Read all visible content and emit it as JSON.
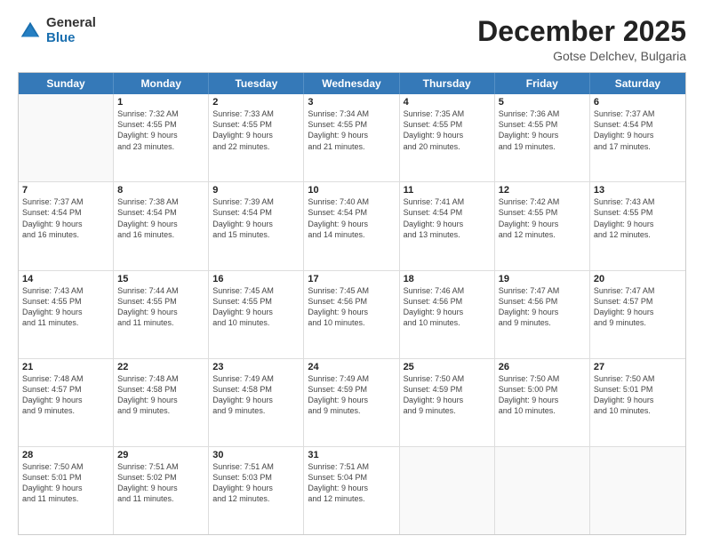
{
  "header": {
    "logo_general": "General",
    "logo_blue": "Blue",
    "month_title": "December 2025",
    "location": "Gotse Delchev, Bulgaria"
  },
  "days_of_week": [
    "Sunday",
    "Monday",
    "Tuesday",
    "Wednesday",
    "Thursday",
    "Friday",
    "Saturday"
  ],
  "rows": [
    [
      {
        "day": "",
        "lines": []
      },
      {
        "day": "1",
        "lines": [
          "Sunrise: 7:32 AM",
          "Sunset: 4:55 PM",
          "Daylight: 9 hours",
          "and 23 minutes."
        ]
      },
      {
        "day": "2",
        "lines": [
          "Sunrise: 7:33 AM",
          "Sunset: 4:55 PM",
          "Daylight: 9 hours",
          "and 22 minutes."
        ]
      },
      {
        "day": "3",
        "lines": [
          "Sunrise: 7:34 AM",
          "Sunset: 4:55 PM",
          "Daylight: 9 hours",
          "and 21 minutes."
        ]
      },
      {
        "day": "4",
        "lines": [
          "Sunrise: 7:35 AM",
          "Sunset: 4:55 PM",
          "Daylight: 9 hours",
          "and 20 minutes."
        ]
      },
      {
        "day": "5",
        "lines": [
          "Sunrise: 7:36 AM",
          "Sunset: 4:55 PM",
          "Daylight: 9 hours",
          "and 19 minutes."
        ]
      },
      {
        "day": "6",
        "lines": [
          "Sunrise: 7:37 AM",
          "Sunset: 4:54 PM",
          "Daylight: 9 hours",
          "and 17 minutes."
        ]
      }
    ],
    [
      {
        "day": "7",
        "lines": [
          "Sunrise: 7:37 AM",
          "Sunset: 4:54 PM",
          "Daylight: 9 hours",
          "and 16 minutes."
        ]
      },
      {
        "day": "8",
        "lines": [
          "Sunrise: 7:38 AM",
          "Sunset: 4:54 PM",
          "Daylight: 9 hours",
          "and 16 minutes."
        ]
      },
      {
        "day": "9",
        "lines": [
          "Sunrise: 7:39 AM",
          "Sunset: 4:54 PM",
          "Daylight: 9 hours",
          "and 15 minutes."
        ]
      },
      {
        "day": "10",
        "lines": [
          "Sunrise: 7:40 AM",
          "Sunset: 4:54 PM",
          "Daylight: 9 hours",
          "and 14 minutes."
        ]
      },
      {
        "day": "11",
        "lines": [
          "Sunrise: 7:41 AM",
          "Sunset: 4:54 PM",
          "Daylight: 9 hours",
          "and 13 minutes."
        ]
      },
      {
        "day": "12",
        "lines": [
          "Sunrise: 7:42 AM",
          "Sunset: 4:55 PM",
          "Daylight: 9 hours",
          "and 12 minutes."
        ]
      },
      {
        "day": "13",
        "lines": [
          "Sunrise: 7:43 AM",
          "Sunset: 4:55 PM",
          "Daylight: 9 hours",
          "and 12 minutes."
        ]
      }
    ],
    [
      {
        "day": "14",
        "lines": [
          "Sunrise: 7:43 AM",
          "Sunset: 4:55 PM",
          "Daylight: 9 hours",
          "and 11 minutes."
        ]
      },
      {
        "day": "15",
        "lines": [
          "Sunrise: 7:44 AM",
          "Sunset: 4:55 PM",
          "Daylight: 9 hours",
          "and 11 minutes."
        ]
      },
      {
        "day": "16",
        "lines": [
          "Sunrise: 7:45 AM",
          "Sunset: 4:55 PM",
          "Daylight: 9 hours",
          "and 10 minutes."
        ]
      },
      {
        "day": "17",
        "lines": [
          "Sunrise: 7:45 AM",
          "Sunset: 4:56 PM",
          "Daylight: 9 hours",
          "and 10 minutes."
        ]
      },
      {
        "day": "18",
        "lines": [
          "Sunrise: 7:46 AM",
          "Sunset: 4:56 PM",
          "Daylight: 9 hours",
          "and 10 minutes."
        ]
      },
      {
        "day": "19",
        "lines": [
          "Sunrise: 7:47 AM",
          "Sunset: 4:56 PM",
          "Daylight: 9 hours",
          "and 9 minutes."
        ]
      },
      {
        "day": "20",
        "lines": [
          "Sunrise: 7:47 AM",
          "Sunset: 4:57 PM",
          "Daylight: 9 hours",
          "and 9 minutes."
        ]
      }
    ],
    [
      {
        "day": "21",
        "lines": [
          "Sunrise: 7:48 AM",
          "Sunset: 4:57 PM",
          "Daylight: 9 hours",
          "and 9 minutes."
        ]
      },
      {
        "day": "22",
        "lines": [
          "Sunrise: 7:48 AM",
          "Sunset: 4:58 PM",
          "Daylight: 9 hours",
          "and 9 minutes."
        ]
      },
      {
        "day": "23",
        "lines": [
          "Sunrise: 7:49 AM",
          "Sunset: 4:58 PM",
          "Daylight: 9 hours",
          "and 9 minutes."
        ]
      },
      {
        "day": "24",
        "lines": [
          "Sunrise: 7:49 AM",
          "Sunset: 4:59 PM",
          "Daylight: 9 hours",
          "and 9 minutes."
        ]
      },
      {
        "day": "25",
        "lines": [
          "Sunrise: 7:50 AM",
          "Sunset: 4:59 PM",
          "Daylight: 9 hours",
          "and 9 minutes."
        ]
      },
      {
        "day": "26",
        "lines": [
          "Sunrise: 7:50 AM",
          "Sunset: 5:00 PM",
          "Daylight: 9 hours",
          "and 10 minutes."
        ]
      },
      {
        "day": "27",
        "lines": [
          "Sunrise: 7:50 AM",
          "Sunset: 5:01 PM",
          "Daylight: 9 hours",
          "and 10 minutes."
        ]
      }
    ],
    [
      {
        "day": "28",
        "lines": [
          "Sunrise: 7:50 AM",
          "Sunset: 5:01 PM",
          "Daylight: 9 hours",
          "and 11 minutes."
        ]
      },
      {
        "day": "29",
        "lines": [
          "Sunrise: 7:51 AM",
          "Sunset: 5:02 PM",
          "Daylight: 9 hours",
          "and 11 minutes."
        ]
      },
      {
        "day": "30",
        "lines": [
          "Sunrise: 7:51 AM",
          "Sunset: 5:03 PM",
          "Daylight: 9 hours",
          "and 12 minutes."
        ]
      },
      {
        "day": "31",
        "lines": [
          "Sunrise: 7:51 AM",
          "Sunset: 5:04 PM",
          "Daylight: 9 hours",
          "and 12 minutes."
        ]
      },
      {
        "day": "",
        "lines": []
      },
      {
        "day": "",
        "lines": []
      },
      {
        "day": "",
        "lines": []
      }
    ]
  ]
}
